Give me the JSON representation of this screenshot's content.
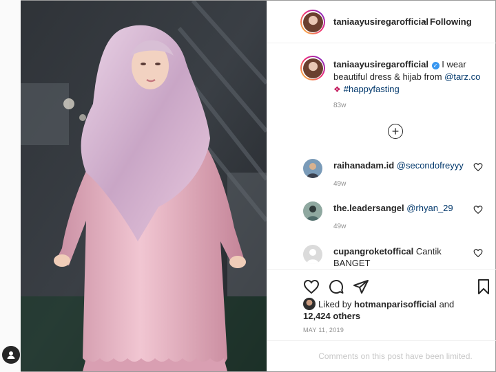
{
  "header": {
    "username": "taniaayusiregarofficial",
    "separator": "•",
    "follow_status": "Following"
  },
  "caption": {
    "username": "taniaayusiregarofficial",
    "verified_icon": "verified-badge-icon",
    "text_before_link": "I wear beautiful dress & hijab from ",
    "link_mention": "@tarz.co",
    "ornament_icon": "ornament-icon",
    "hashtag": "#happyfasting",
    "time": "83w"
  },
  "load_more": {
    "icon": "plus-circle-icon",
    "label": "+"
  },
  "comments": [
    {
      "username": "raihanadam.id",
      "text": "@secondofreyyy",
      "time": "49w"
    },
    {
      "username": "the.leadersangel",
      "text": "@rhyan_29",
      "time": "49w"
    },
    {
      "username": "cupangroketoffical",
      "text": "Cantik BANGET",
      "time": ""
    }
  ],
  "actions": {
    "like_icon": "heart-icon",
    "comment_icon": "comment-icon",
    "share_icon": "share-icon",
    "save_icon": "bookmark-icon"
  },
  "likes": {
    "prefix": "Liked by ",
    "username": "hotmanparisofficial",
    "suffix": " and",
    "others": "12,424 others"
  },
  "date": "MAY 11, 2019",
  "comments_limited": "Comments on this post have been limited.",
  "colors": {
    "accent_link": "#00376b",
    "verified": "#3897f0",
    "muted": "#8e8e8e",
    "border": "#efefef",
    "dress": "#e7b6c4"
  }
}
